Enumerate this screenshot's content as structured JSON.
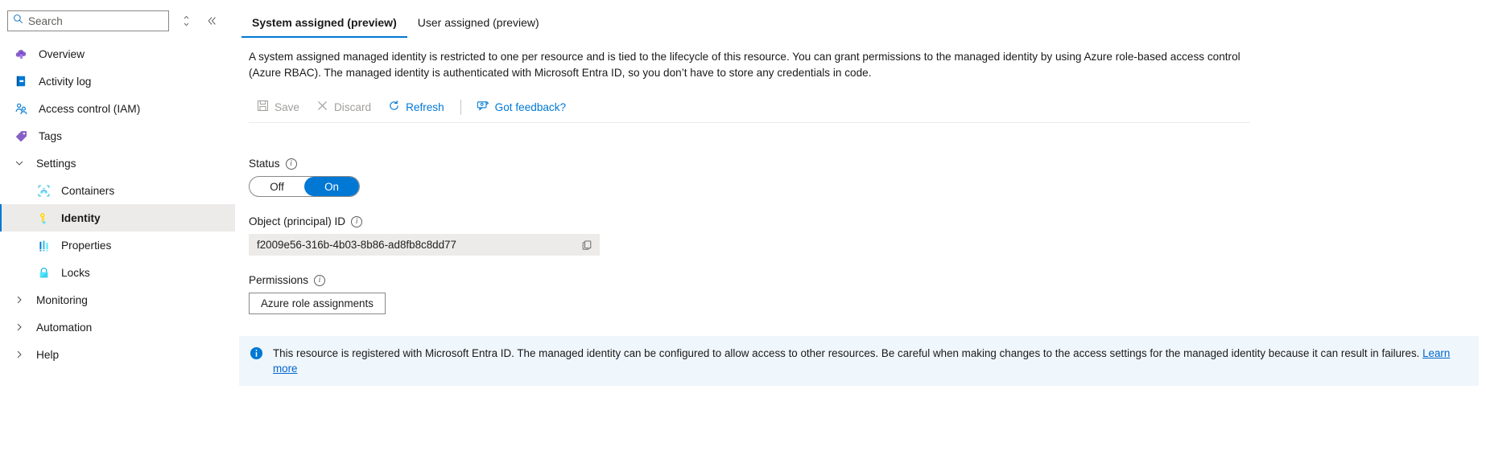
{
  "sidebar": {
    "search": {
      "placeholder": "Search",
      "value": ""
    },
    "sort_tooltip": "Sort",
    "collapse_tooltip": "Collapse",
    "items": [
      {
        "label": "Overview",
        "icon": "cloud-upload-icon",
        "type": "leaf",
        "selected": false
      },
      {
        "label": "Activity log",
        "icon": "activity-log-icon",
        "type": "leaf",
        "selected": false
      },
      {
        "label": "Access control (IAM)",
        "icon": "people-icon",
        "type": "leaf",
        "selected": false
      },
      {
        "label": "Tags",
        "icon": "tag-icon",
        "type": "leaf",
        "selected": false
      },
      {
        "label": "Settings",
        "icon": "chevron-down-icon",
        "type": "group-open",
        "selected": false
      },
      {
        "label": "Containers",
        "icon": "containers-icon",
        "type": "child",
        "selected": false
      },
      {
        "label": "Identity",
        "icon": "key-icon",
        "type": "child",
        "selected": true
      },
      {
        "label": "Properties",
        "icon": "properties-icon",
        "type": "child",
        "selected": false
      },
      {
        "label": "Locks",
        "icon": "lock-icon",
        "type": "child",
        "selected": false
      },
      {
        "label": "Monitoring",
        "icon": "chevron-right-icon",
        "type": "group",
        "selected": false
      },
      {
        "label": "Automation",
        "icon": "chevron-right-icon",
        "type": "group",
        "selected": false
      },
      {
        "label": "Help",
        "icon": "chevron-right-icon",
        "type": "group",
        "selected": false
      }
    ]
  },
  "main": {
    "tabs": [
      {
        "label": "System assigned (preview)",
        "active": true
      },
      {
        "label": "User assigned (preview)",
        "active": false
      }
    ],
    "description": "A system assigned managed identity is restricted to one per resource and is tied to the lifecycle of this resource. You can grant permissions to the managed identity by using Azure role-based access control (Azure RBAC). The managed identity is authenticated with Microsoft Entra ID, so you don’t have to store any credentials in code.",
    "toolbar": [
      {
        "label": "Save",
        "icon": "save-icon",
        "disabled": true
      },
      {
        "label": "Discard",
        "icon": "discard-icon",
        "disabled": true
      },
      {
        "label": "Refresh",
        "icon": "refresh-icon",
        "disabled": false
      },
      {
        "label": "Got feedback?",
        "icon": "feedback-icon",
        "disabled": false
      }
    ],
    "status": {
      "label": "Status",
      "info_tooltip": "Status info",
      "options": [
        "Off",
        "On"
      ],
      "selected": "On"
    },
    "object_id": {
      "label": "Object (principal) ID",
      "info_tooltip": "Object ID info",
      "value": "f2009e56-316b-4b03-8b86-ad8fb8c8dd77",
      "copy_tooltip": "Copy to clipboard"
    },
    "permissions": {
      "label": "Permissions",
      "info_tooltip": "Permissions info",
      "button_label": "Azure role assignments"
    },
    "banner": {
      "icon": "info-circle-icon",
      "text": "This resource is registered with Microsoft Entra ID. The managed identity can be configured to allow access to other resources. Be careful when making changes to the access settings for the managed identity because it can result in failures. ",
      "link_label": "Learn more"
    }
  },
  "colors": {
    "accent": "#0078d4",
    "selected_bg": "#edebe9",
    "banner_bg": "#eff6fc",
    "link": "#0066cc",
    "disabled_text": "#a19f9d"
  }
}
